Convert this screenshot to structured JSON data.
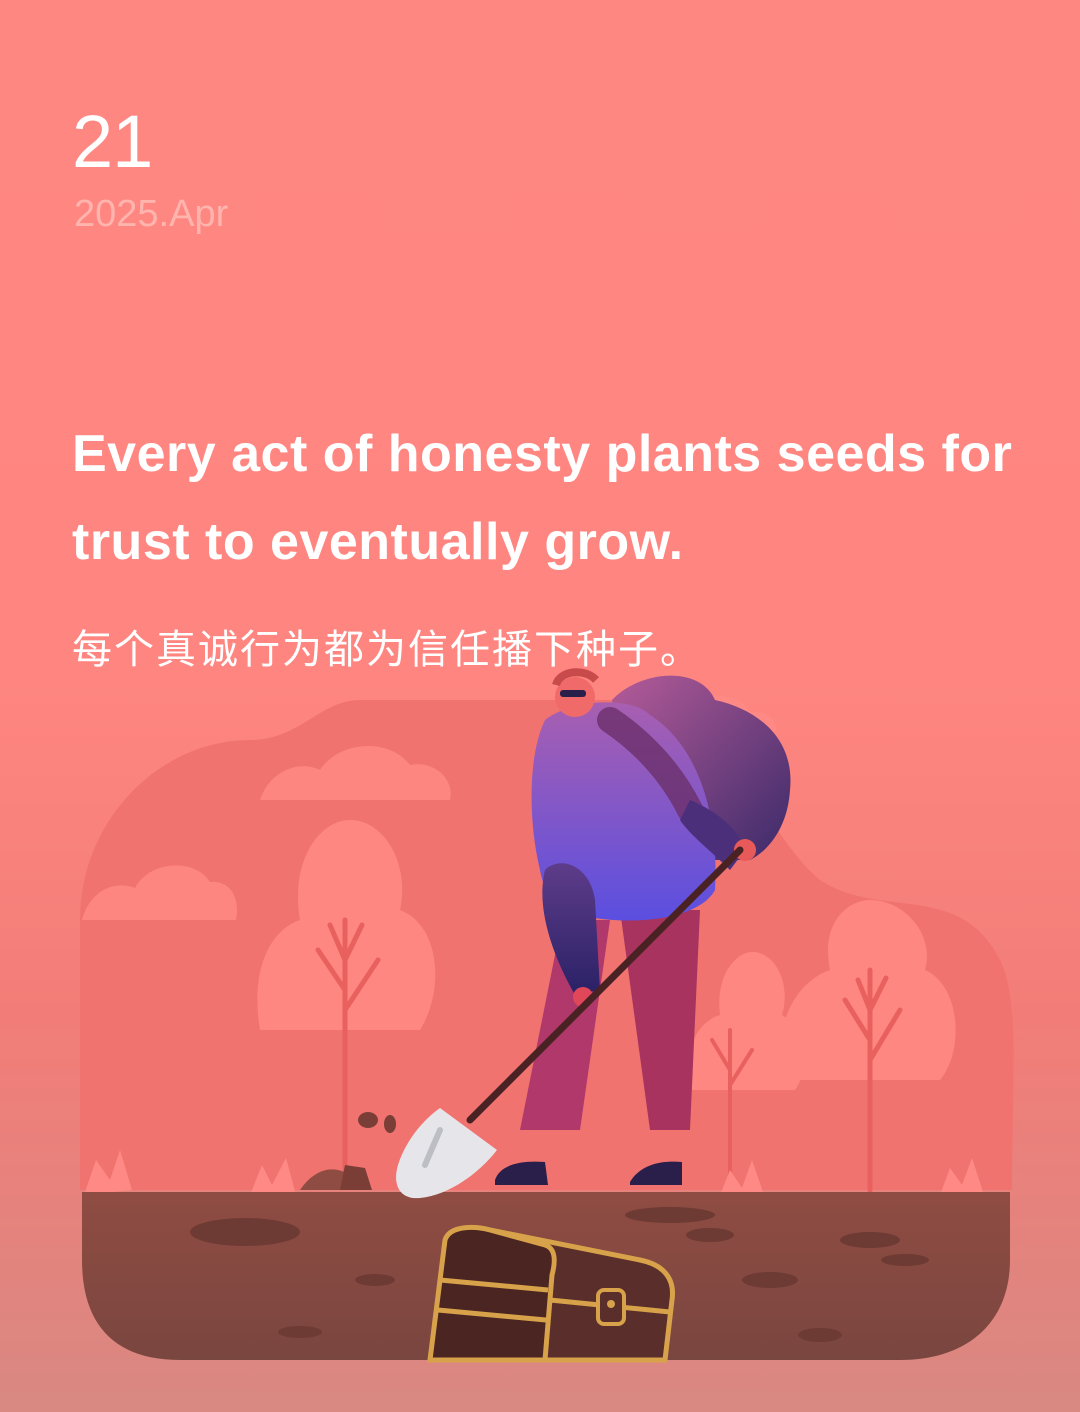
{
  "date": {
    "day": "21",
    "month_year": "2025.Apr"
  },
  "quote": {
    "english": "Every act of honesty plants seeds for trust to eventually grow.",
    "chinese": "每个真诚行为都为信任播下种子。"
  },
  "colors": {
    "background": "#ff8782",
    "text": "#ffffff",
    "subtle_text": "#ffb4ae",
    "soil": "#8b4a40",
    "shirt": "#7a5ae0",
    "pants": "#b0386a"
  },
  "illustration": {
    "icons": [
      "tree-icon",
      "cloud-icon",
      "person-digging-icon",
      "shovel-icon",
      "treasure-chest-icon"
    ]
  }
}
